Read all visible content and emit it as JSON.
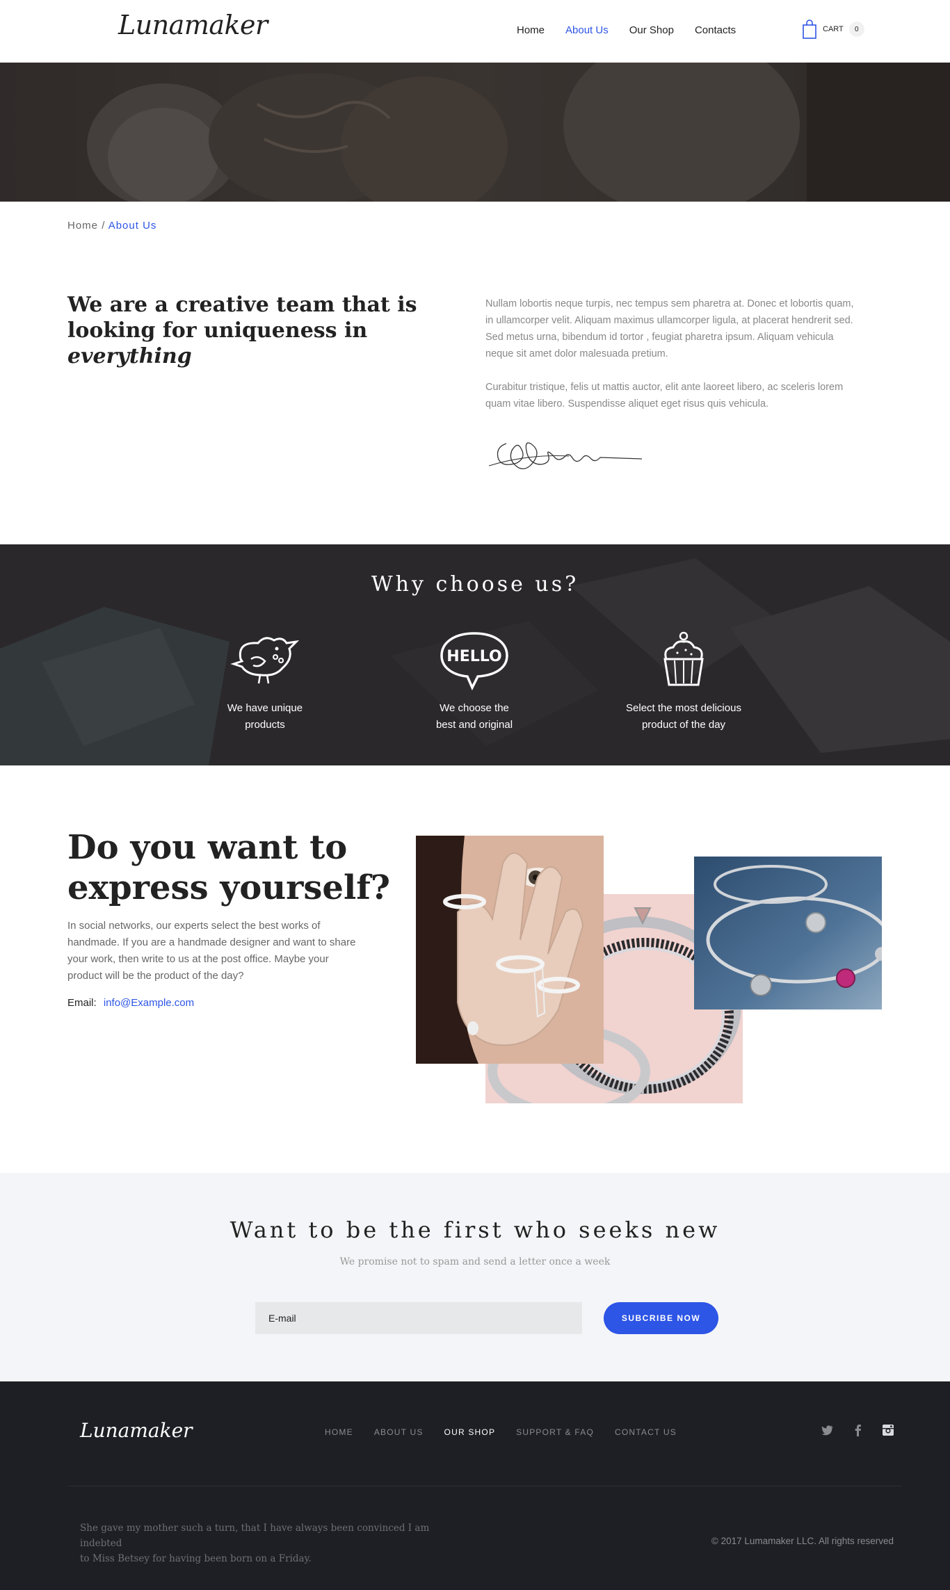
{
  "brand": {
    "logo": "Lunamaker",
    "accent_color": "#2d55e6"
  },
  "nav": {
    "items": [
      {
        "label": "Home",
        "active": false
      },
      {
        "label": "About Us",
        "active": true
      },
      {
        "label": "Our Shop",
        "active": false
      },
      {
        "label": "Contacts",
        "active": false
      }
    ]
  },
  "cart": {
    "label": "CART",
    "count": "0",
    "icon": "shopping-bag-icon"
  },
  "breadcrumb": {
    "home": "Home",
    "separator": "/",
    "current": "About Us"
  },
  "about": {
    "title_lines": [
      "We are a creative team that is",
      "looking for uniqueness in"
    ],
    "title_emphasis": "everything",
    "paragraph1": "Nullam lobortis neque turpis, nec tempus sem pharetra at. Donec et lobortis quam, in ullamcorper velit. Aliquam maximus ullamcorper ligula, at placerat hendrerit sed. Sed metus urna, bibendum id tortor , feugiat pharetra ipsum. Aliquam vehicula neque sit amet dolor malesuada pretium.",
    "paragraph2": "Curabitur tristique, felis ut mattis auctor, elit ante laoreet libero, ac sceleris lorem quam vitae libero. Suspendisse aliquet eget risus quis vehicula."
  },
  "why": {
    "title": "Why choose us?",
    "features": [
      {
        "icon": "bird-icon",
        "line1": "We have unique",
        "line2": "products"
      },
      {
        "icon": "hello-bubble-icon",
        "line1": "We choose the",
        "line2": "best and original"
      },
      {
        "icon": "cupcake-icon",
        "line1": "Select the most delicious",
        "line2": "product of the day"
      }
    ]
  },
  "express": {
    "title_line1": "Do you want to",
    "title_line2": "express yourself?",
    "text": "In social networks, our experts select the best works of handmade. If you are a handmade designer and want to share your work, then write to us at the post office. Maybe your product will be the product of the day?",
    "email_label": "Email:",
    "email": "info@Example.com"
  },
  "newsletter": {
    "title": "Want to be the first who seeks new",
    "subtitle": "We promise not to spam and send a letter once a week",
    "placeholder": "E-mail",
    "button": "SUBCRIBE NOW"
  },
  "footer": {
    "logo": "Lunamaker",
    "nav": [
      {
        "label": "HOME",
        "highlight": false
      },
      {
        "label": "ABOUT US",
        "highlight": false
      },
      {
        "label": "OUR SHOP",
        "highlight": true
      },
      {
        "label": "SUPPORT & FAQ",
        "highlight": false
      },
      {
        "label": "CONTACT US",
        "highlight": false
      }
    ],
    "social_icons": [
      "twitter-icon",
      "facebook-icon",
      "instagram-icon"
    ],
    "quote_line1": "She gave my mother such a turn, that I have always been convinced I am indebted",
    "quote_line2": "to Miss Betsey for having been born on a Friday.",
    "copyright": "© 2017 Lumamaker LLC. All rights reserved"
  }
}
